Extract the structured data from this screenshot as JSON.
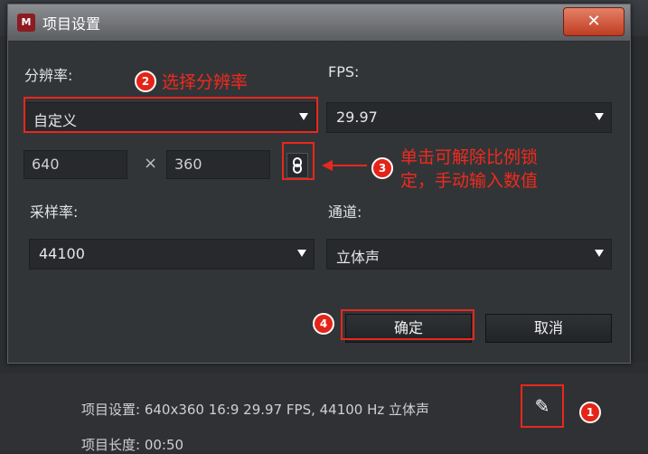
{
  "dialog": {
    "title": "项目设置",
    "close_label": "✕",
    "resolution_label": "分辨率:",
    "resolution_value": "自定义",
    "fps_label": "FPS:",
    "fps_value": "29.97",
    "width_value": "640",
    "times_sign": "×",
    "height_value": "360",
    "lock_glyph": "✂",
    "samplerate_label": "采样率:",
    "samplerate_value": "44100",
    "channel_label": "通道:",
    "channel_value": "立体声",
    "ok_label": "确定",
    "cancel_label": "取消"
  },
  "annotations": {
    "step1": "1",
    "step2": "2",
    "step2_text": "选择分辨率",
    "step3": "3",
    "step3_line1": "单击可解除比例锁",
    "step3_line2": "定，手动输入数值",
    "step4": "4"
  },
  "info": {
    "settings_text": "项目设置: 640x360 16:9 29.97 FPS, 44100 Hz 立体声",
    "length_text": "项目长度: 00:50"
  },
  "icons": {
    "pencil": "✎",
    "app": "M"
  },
  "colors": {
    "annotation_red": "#e8281c",
    "close_button": "#cf4a2e",
    "dialog_bg": "#323538"
  }
}
